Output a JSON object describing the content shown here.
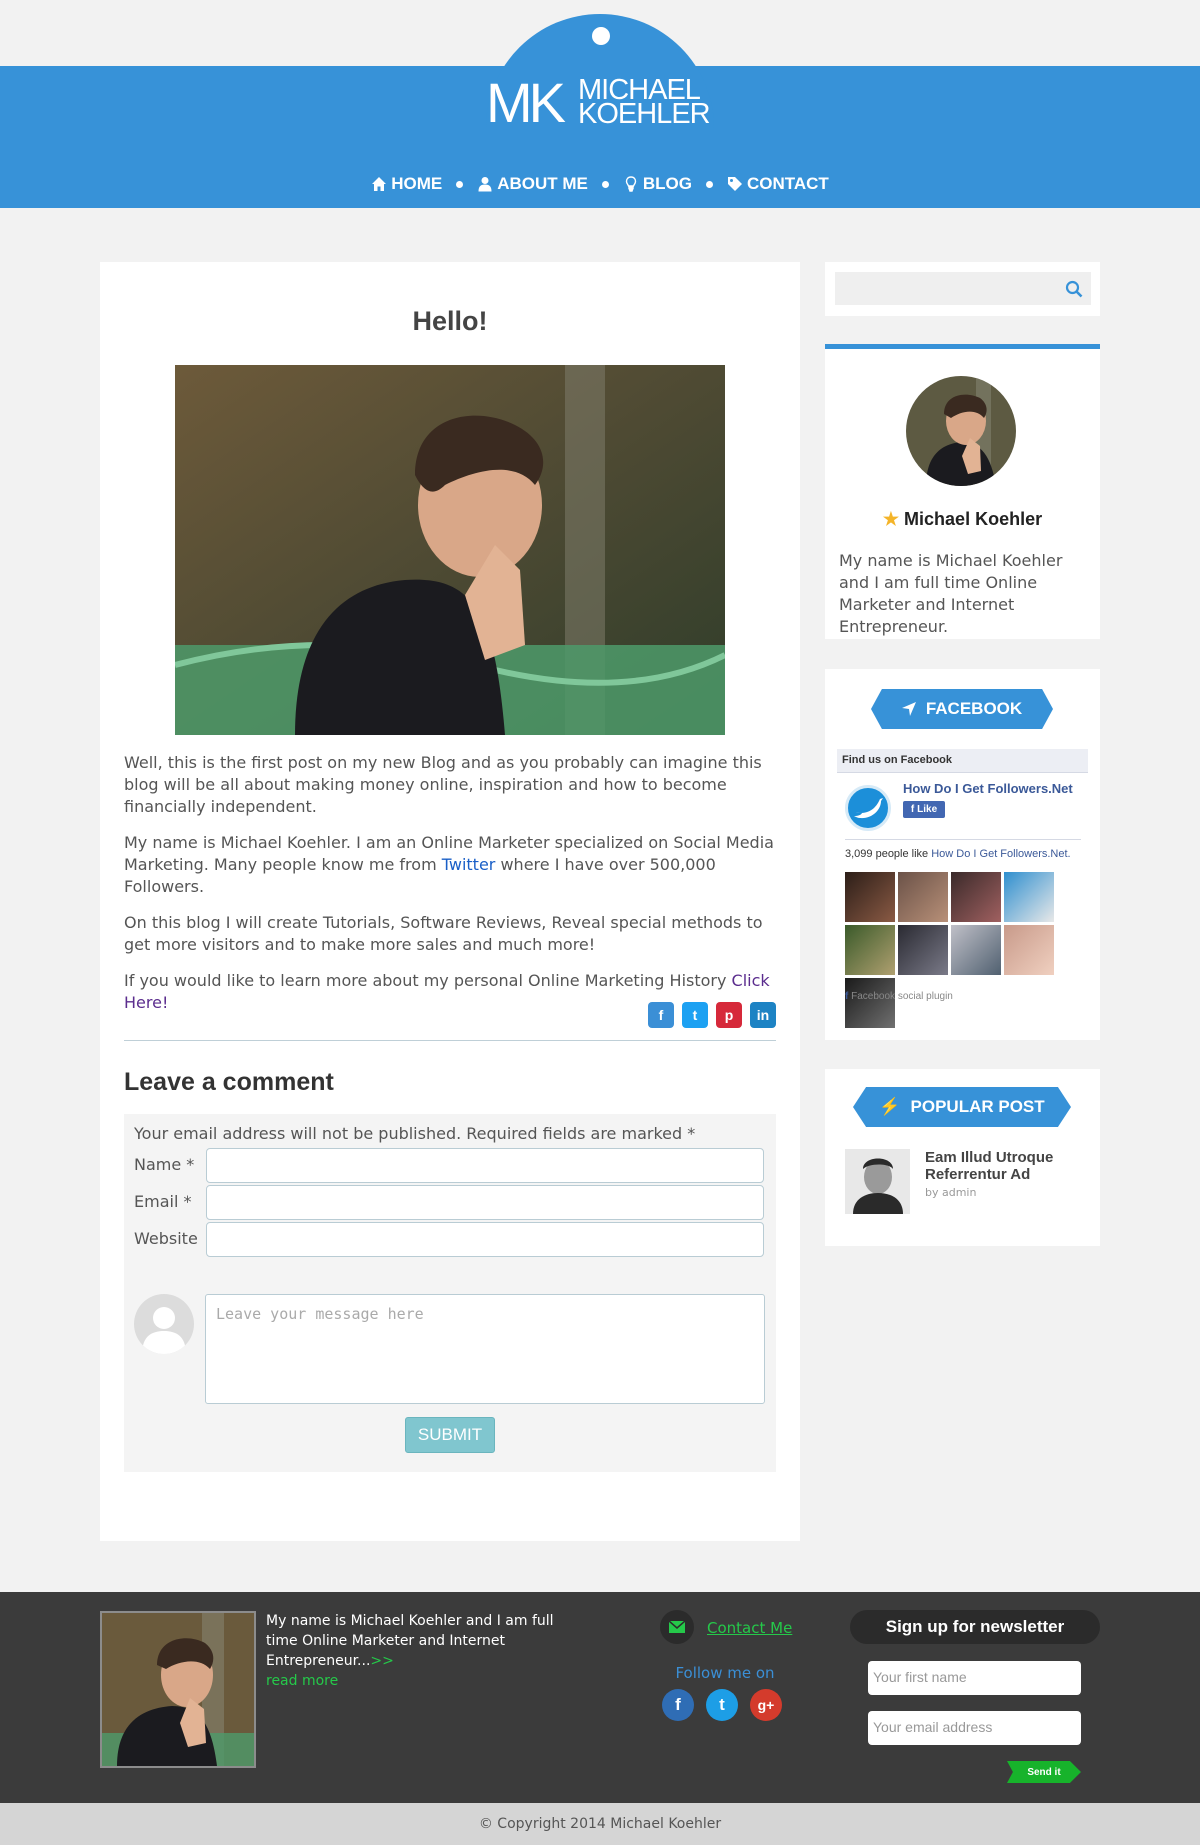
{
  "brand": {
    "mk": "MK",
    "name_line1": "MICHAEL",
    "name_line2": "KOEHLER"
  },
  "nav": [
    {
      "label": "HOME",
      "icon": "home-icon"
    },
    {
      "label": "ABOUT ME",
      "icon": "user-icon"
    },
    {
      "label": "BLOG",
      "icon": "lightbulb-icon"
    },
    {
      "label": "CONTACT",
      "icon": "tag-icon"
    }
  ],
  "post": {
    "title": "Hello!",
    "p1": "Well, this is the first post on my new Blog and as you probably can imagine this blog will be all about making money online, inspiration and how to become financially independent.",
    "p2_before": "My name is Michael Koehler. I am an Online Marketer specialized on Social Media Marketing. Many people know me from ",
    "p2_link": "Twitter",
    "p2_after": " where I have over 500,000 Followers.",
    "p3": "On this blog I will create Tutorials, Software Reviews, Reveal special methods to get more visitors and to make more sales and much more!",
    "p4_before": "If you would like to learn more about my personal Online Marketing History ",
    "p4_link": "Click Here!",
    "share": [
      {
        "icon": "facebook-icon",
        "glyph": "f",
        "color": "#3b8fd6"
      },
      {
        "icon": "twitter-icon",
        "glyph": "t",
        "color": "#1da1f2"
      },
      {
        "icon": "pinterest-icon",
        "glyph": "p",
        "color": "#d6293a"
      },
      {
        "icon": "linkedin-icon",
        "glyph": "in",
        "color": "#1d83c4"
      }
    ]
  },
  "comment": {
    "title": "Leave a comment",
    "note": "Your email address will not be published. Required fields are marked *",
    "name_label": "Name *",
    "email_label": "Email *",
    "website_label": "Website",
    "message_placeholder": "Leave your message here",
    "submit": "SUBMIT"
  },
  "sidebar": {
    "profile": {
      "name": "Michael Koehler",
      "desc": "My name is Michael Koehler and I am full time Online Marketer and Internet Entrepreneur."
    },
    "facebook": {
      "ribbon": "FACEBOOK",
      "header": "Find us on Facebook",
      "page_name": "How Do I Get Followers.Net",
      "like": "Like",
      "count_before": "3,099 people like ",
      "count_page": "How Do I Get Followers.Net.",
      "footer": "Facebook social plugin"
    },
    "popular": {
      "ribbon": "POPULAR POST",
      "title": "Eam Illud Utroque Referrentur Ad",
      "by": "by admin"
    }
  },
  "footer": {
    "bio": "My name is Michael Koehler and I am full time Online Marketer and Internet Entrepreneur...",
    "arrows": ">>",
    "read_more": "read more",
    "contact": "Contact Me",
    "follow": "Follow me on",
    "newsletter_title": "Sign up for newsletter",
    "first_name_placeholder": "Your first name",
    "email_placeholder": "Your email address",
    "send": "Send it",
    "copyright": "© Copyright 2014 Michael Koehler"
  },
  "colors": {
    "accent": "#3792d8",
    "green": "#25c94a",
    "footer_bg": "#3b3b3b"
  }
}
